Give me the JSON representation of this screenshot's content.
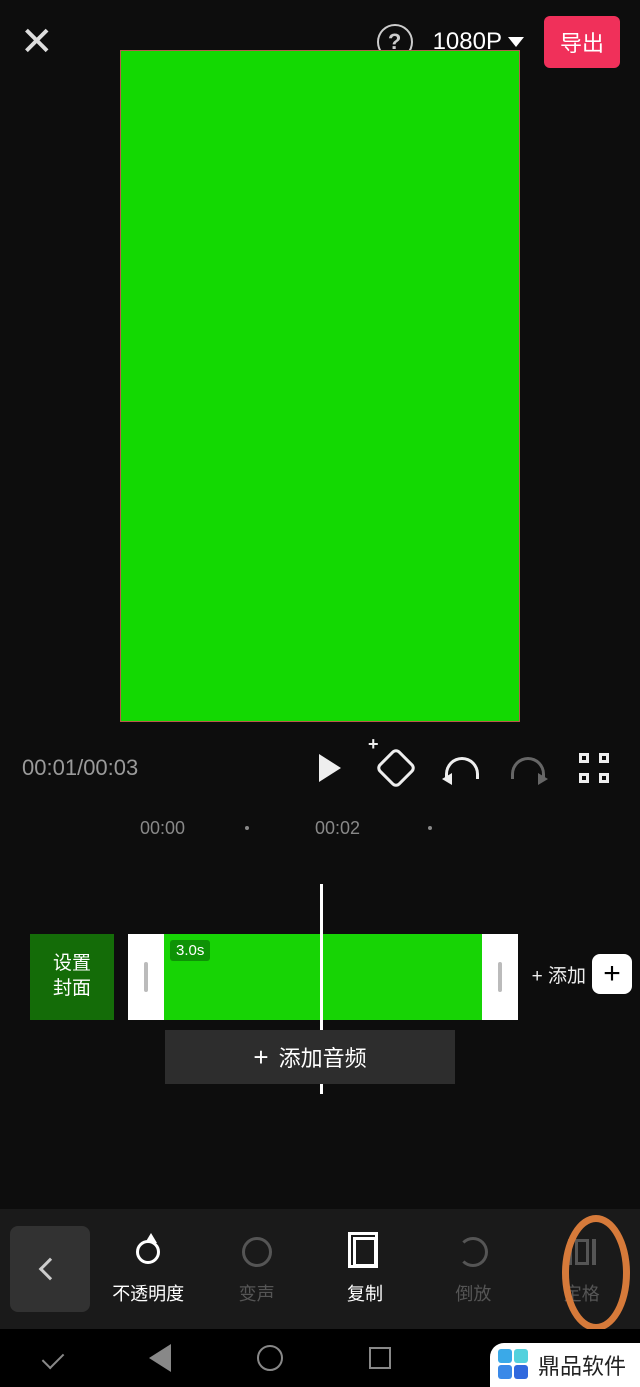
{
  "header": {
    "resolution": "1080P",
    "export_label": "导出"
  },
  "playback": {
    "current_time": "00:01",
    "total_time": "00:03"
  },
  "ruler": {
    "t0": "00:00",
    "t2": "00:02"
  },
  "timeline": {
    "cover_button_line1": "设置",
    "cover_button_line2": "封面",
    "clip_duration": "3.0s",
    "add_clip_label": "+ 添加",
    "add_audio_label": "添加音频",
    "plus": "+"
  },
  "tools": {
    "opacity": "不透明度",
    "voice": "变声",
    "copy": "复制",
    "reverse": "倒放",
    "freeze": "定格"
  },
  "watermark": {
    "text": "鼎品软件"
  }
}
